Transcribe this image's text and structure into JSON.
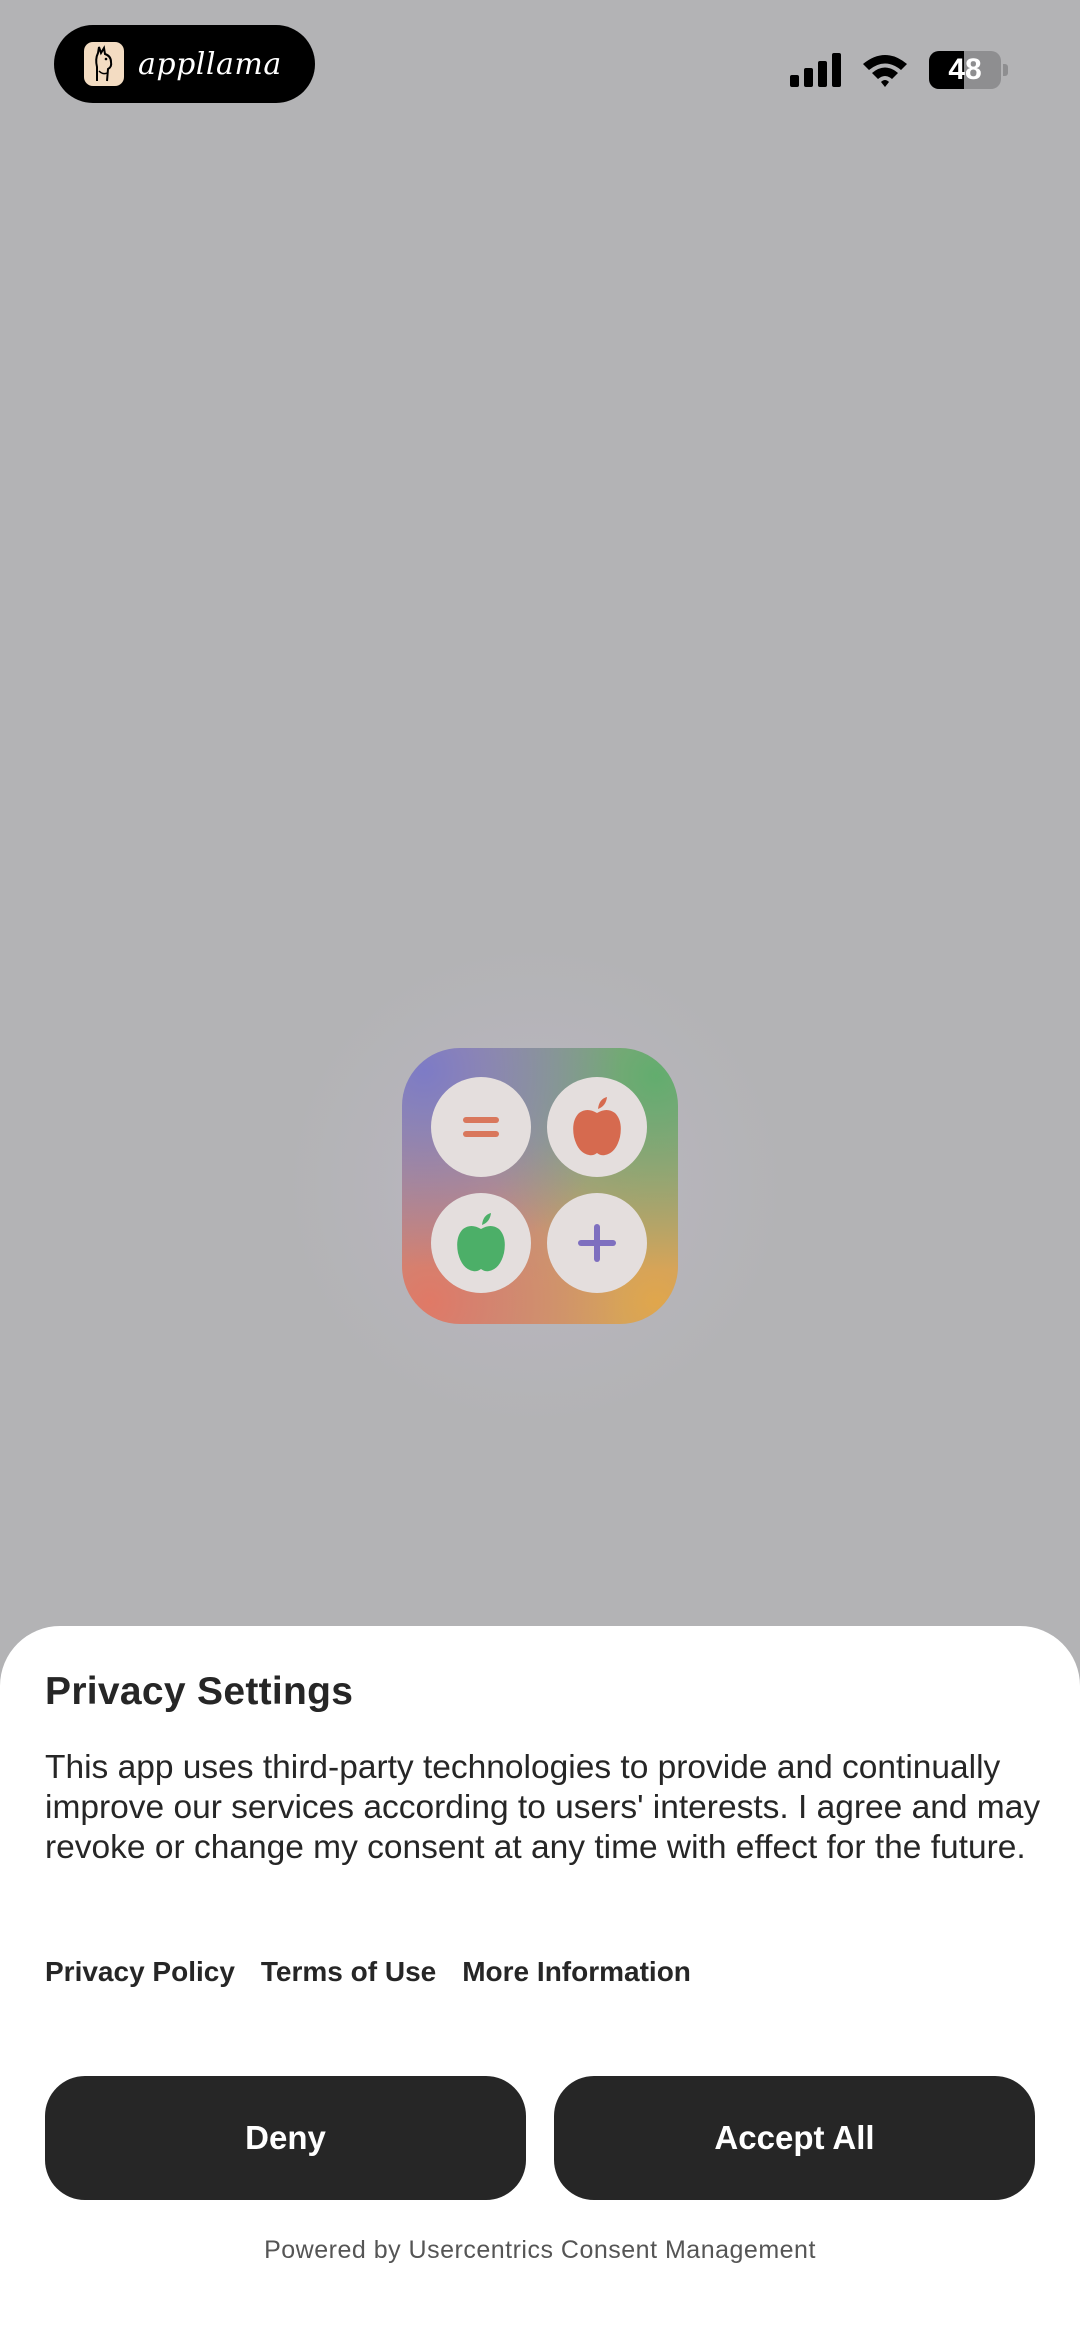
{
  "status_bar": {
    "app_name": "appllama",
    "battery_percent": 48,
    "icons": [
      "llama-logo-icon",
      "cellular-signal-icon",
      "wifi-icon",
      "battery-icon"
    ]
  },
  "app_icon": {
    "icons": [
      "equals-icon",
      "red-apple-icon",
      "green-apple-icon",
      "plus-icon"
    ]
  },
  "privacy": {
    "title": "Privacy Settings",
    "body": "This app uses third-party technologies to provide and continually improve our services according to users' interests. I agree and may revoke or change my consent at any time with effect for the future.",
    "links": [
      "Privacy Policy",
      "Terms of Use",
      "More Information"
    ],
    "deny_label": "Deny",
    "accept_label": "Accept All",
    "powered_by": "Powered by Usercentrics Consent Management"
  },
  "colors": {
    "backdrop": "#b3b3b5",
    "button": "#262626",
    "sheet": "#ffffff"
  }
}
